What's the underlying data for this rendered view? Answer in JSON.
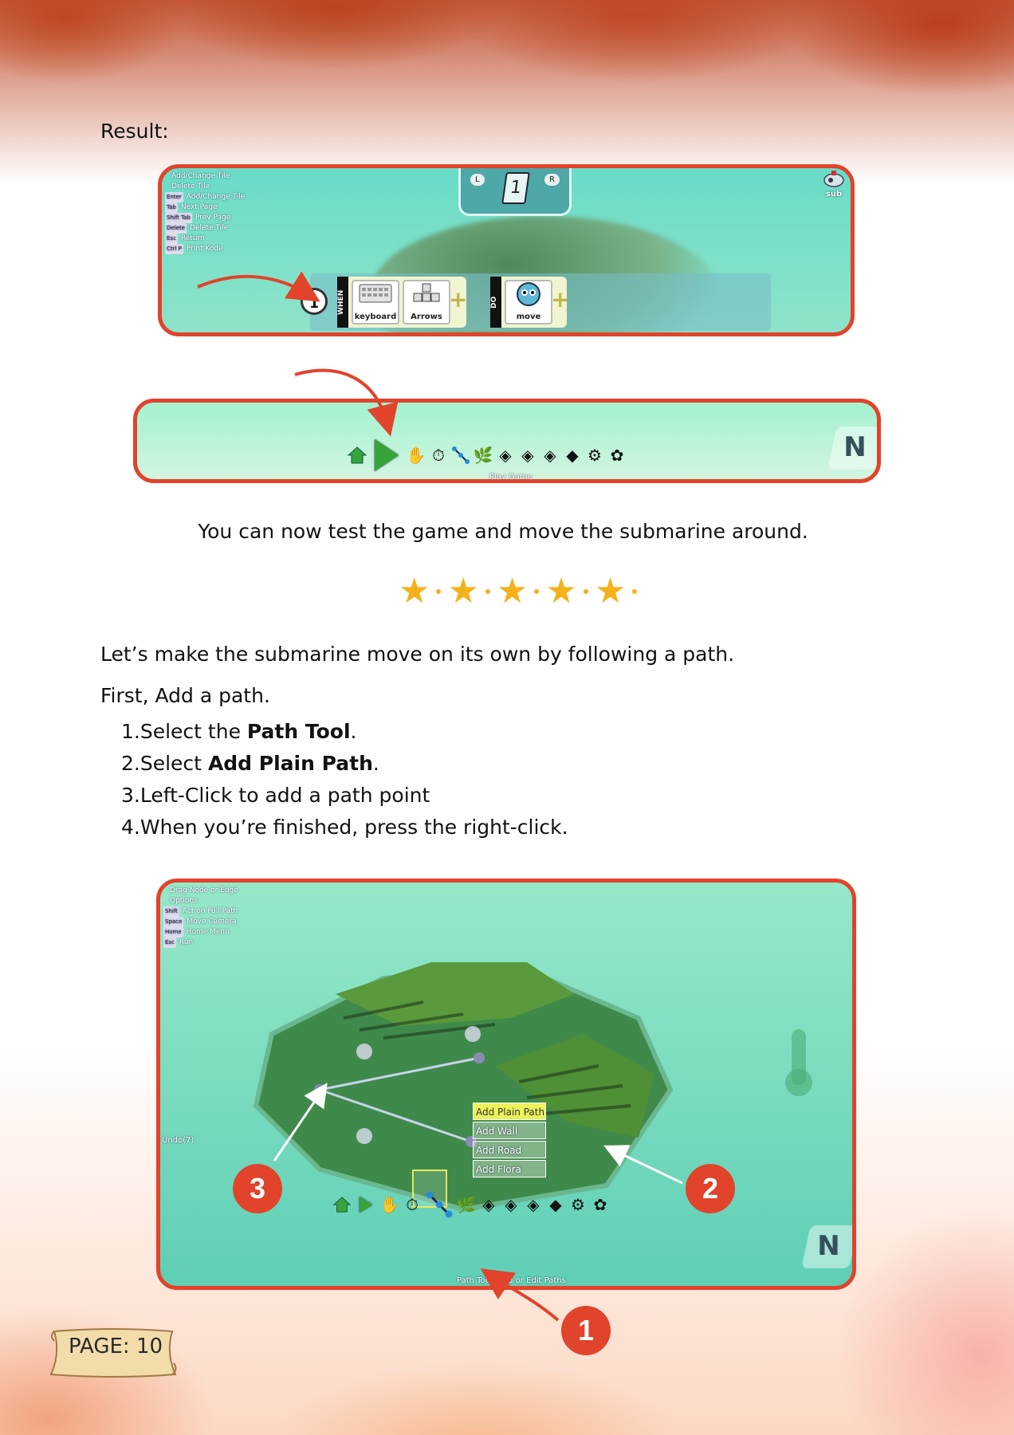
{
  "result_label": "Result:",
  "screen1": {
    "hints": [
      {
        "key": "",
        "text": "Add/Change Tile"
      },
      {
        "key": "",
        "text": "Delete Tile"
      },
      {
        "key": "Enter",
        "text": "Add/Change Tile"
      },
      {
        "key": "Tab",
        "text": "Next Page"
      },
      {
        "key": "Shift Tab",
        "text": "Prev Page"
      },
      {
        "key": "Delete",
        "text": "Delete Tile"
      },
      {
        "key": "Esc",
        "text": "Return"
      },
      {
        "key": "Ctrl P",
        "text": "Print Kode"
      }
    ],
    "page_tab_left": "L",
    "page_tab_right": "R",
    "page_number": "1",
    "row_number": "1",
    "when_label": "WHEN",
    "do_label": "DO",
    "when_tiles": [
      "keyboard",
      "Arrows"
    ],
    "do_tiles": [
      "move"
    ],
    "character_label": "sub"
  },
  "screen2": {
    "tooltip": "Play Game"
  },
  "caption": "You can now test the game and move the submarine around.",
  "intro": "Let’s make the submarine move on its own by following a path.",
  "first": "First, Add a path.",
  "steps": [
    {
      "num": "1.",
      "pre": "Select the ",
      "bold": "Path Tool",
      "post": "."
    },
    {
      "num": "2.",
      "pre": "Select ",
      "bold": "Add Plain Path",
      "post": "."
    },
    {
      "num": "3.",
      "pre": "Left-Click to add a path point",
      "bold": "",
      "post": ""
    },
    {
      "num": "4.",
      "pre": "When you’re finished, press the right-click.",
      "bold": "",
      "post": ""
    }
  ],
  "screen3": {
    "hints": [
      {
        "key": "",
        "text": "Drag Node or Edge"
      },
      {
        "key": "",
        "text": "Options"
      },
      {
        "key": "Shift",
        "text": "Act on Full Path"
      },
      {
        "key": "Space",
        "text": "Move Camera"
      },
      {
        "key": "Home",
        "text": "Home Menu"
      },
      {
        "key": "Esc",
        "text": "Run"
      }
    ],
    "undo": "Undo(7)",
    "menu": [
      "Add Plain Path",
      "Add Wall",
      "Add Road",
      "Add Flora"
    ],
    "tooltip": "Path Tool: Add or Edit Paths"
  },
  "callouts": [
    "1",
    "2",
    "3"
  ],
  "page_label": "PAGE: 10",
  "colors": {
    "frame": "#e1432b",
    "star": "#f4b21a",
    "play": "#37a43a"
  }
}
